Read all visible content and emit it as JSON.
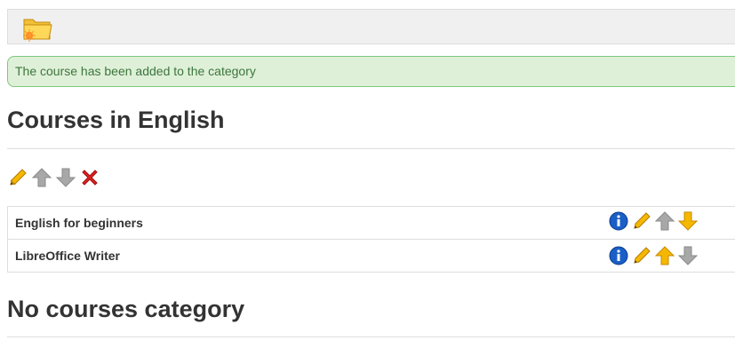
{
  "toolbar": {
    "icon": "add-category-folder-icon"
  },
  "alert": {
    "message": "The course has been added to the category"
  },
  "categories": [
    {
      "title": "Courses in English",
      "actions": [
        "edit-icon",
        "move-up-icon-disabled",
        "move-down-icon-disabled",
        "delete-icon"
      ],
      "courses": [
        {
          "name": "English for beginners",
          "actions": [
            "info-icon",
            "edit-icon",
            "move-up-icon-disabled",
            "move-down-icon"
          ]
        },
        {
          "name": "LibreOffice Writer",
          "actions": [
            "info-icon",
            "edit-icon",
            "move-up-icon",
            "move-down-icon-disabled"
          ]
        }
      ]
    },
    {
      "title": "No courses category"
    }
  ],
  "colors": {
    "alert_bg": "#dff0d8",
    "alert_border": "#7dc97d",
    "alert_text": "#3c763d",
    "arrow_active": "#f5b800",
    "arrow_disabled": "#a8a8a8",
    "delete_red": "#e02020",
    "info_blue": "#1a5fc8"
  }
}
